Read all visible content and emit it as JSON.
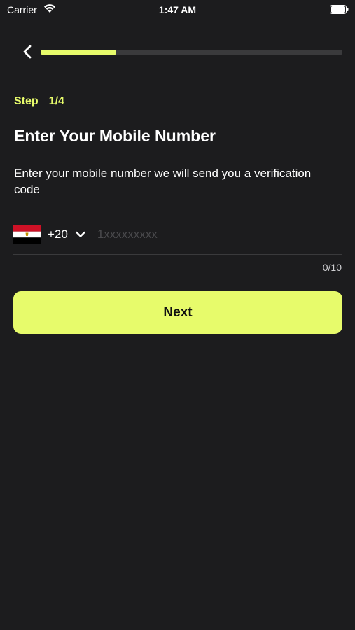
{
  "status_bar": {
    "carrier": "Carrier",
    "time": "1:47 AM"
  },
  "header": {
    "progress": 0.25,
    "progress_color": "#e7fb6b"
  },
  "step": {
    "label": "Step",
    "value": "1/4"
  },
  "title": "Enter Your Mobile Number",
  "subtitle": "Enter your mobile number we will send you a verification code",
  "phone": {
    "country_code": "+20",
    "value": "",
    "placeholder": "1xxxxxxxxx",
    "counter": "0/10"
  },
  "next_button": {
    "label": "Next"
  },
  "colors": {
    "background": "#1c1c1e",
    "accent": "#e7fb6b"
  }
}
